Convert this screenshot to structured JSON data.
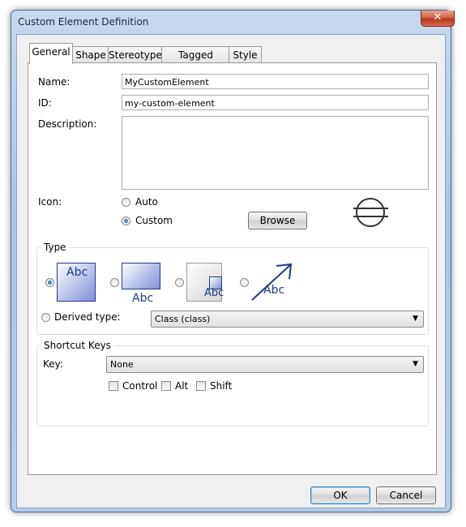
{
  "window": {
    "title": "Custom Element Definition",
    "close_glyph": "✕"
  },
  "tabs": [
    "General",
    "Shape",
    "Stereotypes",
    "Tagged Values",
    "Style"
  ],
  "general": {
    "name_label": "Name:",
    "name_value": "MyCustomElement",
    "id_label": "ID:",
    "id_value": "my-custom-element",
    "description_label": "Description:",
    "description_value": "",
    "icon_label": "Icon:",
    "icon_auto": "Auto",
    "icon_custom": "Custom",
    "icon_selected": "Custom",
    "browse_label": "Browse",
    "icon_preview": "circle-bar-icon"
  },
  "type_group": {
    "legend": "Type",
    "options": [
      {
        "name": "class-style-abc-icon",
        "text": "Abc",
        "selected": true
      },
      {
        "name": "box-label-below-icon",
        "text": "Abc",
        "selected": false
      },
      {
        "name": "box-with-port-icon",
        "text": "Abc",
        "selected": false
      },
      {
        "name": "arrow-abc-icon",
        "text": "Abc",
        "selected": false
      }
    ],
    "derived_label": "Derived type:",
    "derived_value": "Class (class)"
  },
  "shortcut": {
    "legend": "Shortcut Keys",
    "key_label": "Key:",
    "key_value": "None",
    "control": "Control",
    "alt": "Alt",
    "shift": "Shift"
  },
  "buttons": {
    "ok": "OK",
    "cancel": "Cancel"
  },
  "colors": {
    "accent": "#1e3a8a",
    "window_frame": "#aac6e4",
    "focus": "#3c7fb1"
  }
}
